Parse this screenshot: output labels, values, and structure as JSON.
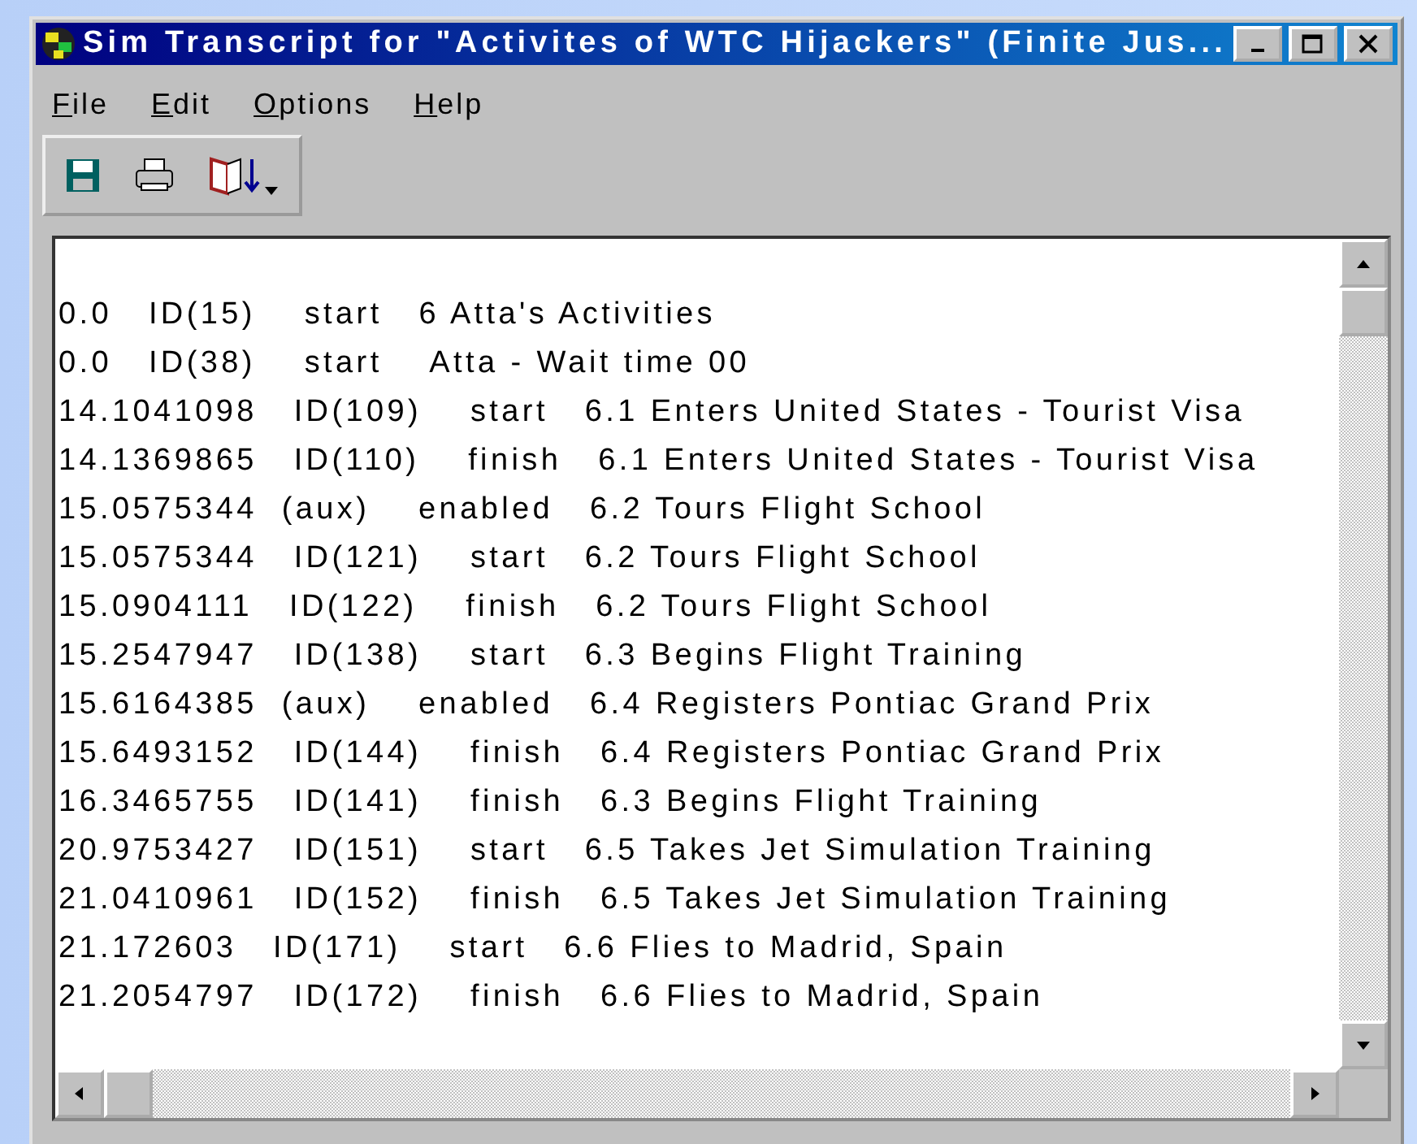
{
  "window": {
    "title": "Sim Transcript for \"Activites of WTC Hijackers\" (Finite Jus..."
  },
  "menu": [
    "File",
    "Edit",
    "Options",
    "Help"
  ],
  "transcript": [
    "0.0   ID(15)    start   6 Atta's Activities",
    "0.0   ID(38)    start    Atta - Wait time 00",
    "14.1041098   ID(109)    start   6.1 Enters United States - Tourist Visa",
    "14.1369865   ID(110)    finish   6.1 Enters United States - Tourist Visa",
    "15.0575344  (aux)    enabled   6.2 Tours Flight School",
    "15.0575344   ID(121)    start   6.2 Tours Flight School",
    "15.0904111   ID(122)    finish   6.2 Tours Flight School",
    "15.2547947   ID(138)    start   6.3 Begins Flight Training",
    "15.6164385  (aux)    enabled   6.4 Registers Pontiac Grand Prix",
    "15.6493152   ID(144)    finish   6.4 Registers Pontiac Grand Prix",
    "16.3465755   ID(141)    finish   6.3 Begins Flight Training",
    "20.9753427   ID(151)    start   6.5 Takes Jet Simulation Training",
    "21.0410961   ID(152)    finish   6.5 Takes Jet Simulation Training",
    "21.172603   ID(171)    start   6.6 Flies to Madrid, Spain",
    "21.2054797   ID(172)    finish   6.6 Flies to Madrid, Spain"
  ]
}
